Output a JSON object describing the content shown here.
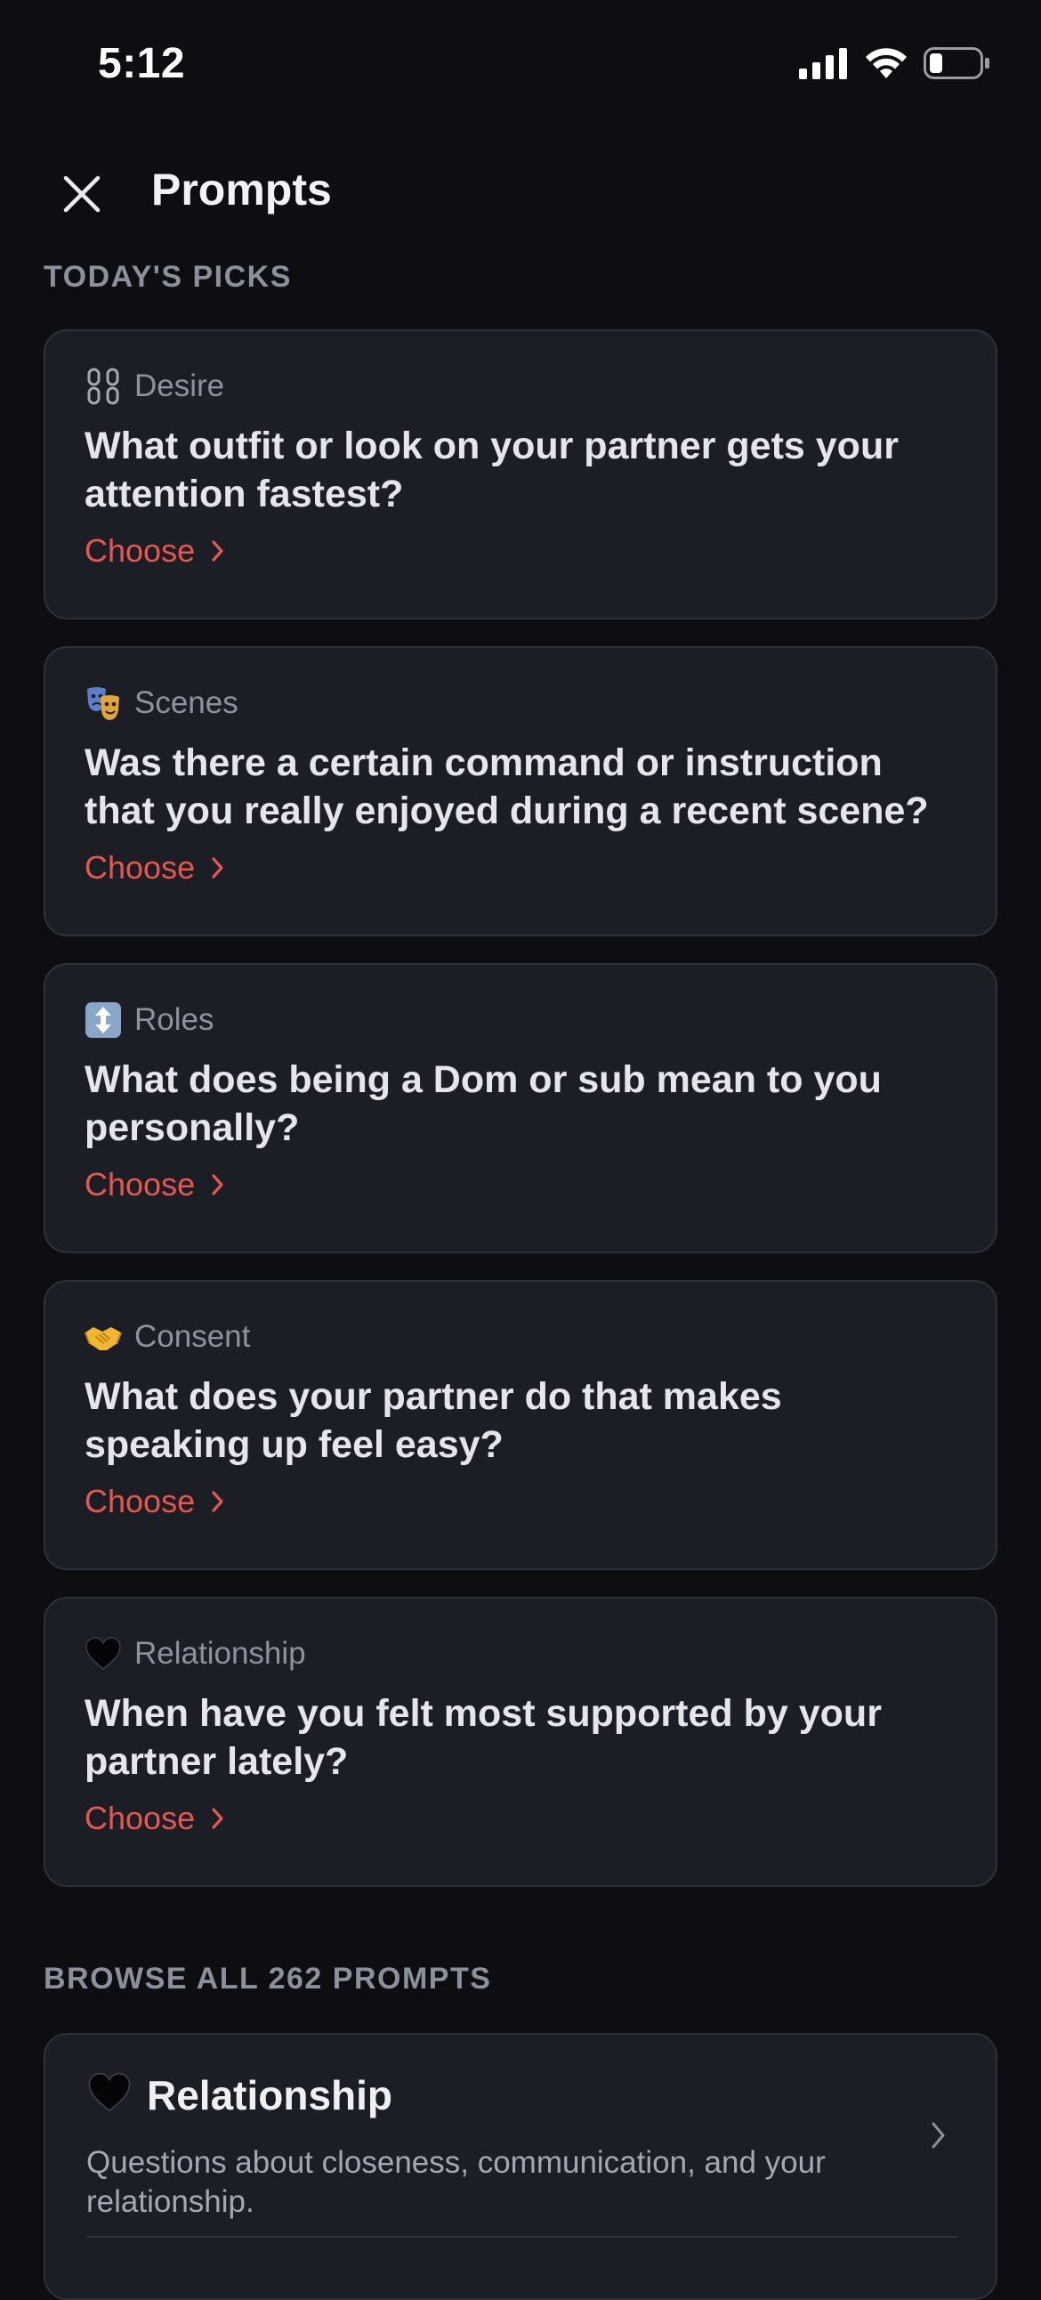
{
  "status_bar": {
    "time": "5:12"
  },
  "header": {
    "title": "Prompts"
  },
  "todays_picks": {
    "label": "TODAY'S PICKS",
    "cards": [
      {
        "category": "Desire",
        "icon": "chains-icon",
        "question": "What outfit or look on your partner gets your attention fastest?",
        "action": "Choose"
      },
      {
        "category": "Scenes",
        "icon": "theater-masks-icon",
        "question": "Was there a certain command or instruction that you really enjoyed during a recent scene?",
        "action": "Choose"
      },
      {
        "category": "Roles",
        "icon": "up-down-arrow-icon",
        "question": "What does being a Dom or sub mean to you personally?",
        "action": "Choose"
      },
      {
        "category": "Consent",
        "icon": "handshake-icon",
        "question": "What does your partner do that makes speaking up feel easy?",
        "action": "Choose"
      },
      {
        "category": "Relationship",
        "icon": "black-heart-icon",
        "question": "When have you felt most supported by your partner lately?",
        "action": "Choose"
      }
    ]
  },
  "browse": {
    "label": "BROWSE ALL 262 PROMPTS",
    "categories": [
      {
        "title": "Relationship",
        "icon": "black-heart-icon",
        "description": "Questions about closeness, communication, and your relationship."
      }
    ]
  },
  "colors": {
    "background": "#0d0e12",
    "card": "#1b1e25",
    "card_border": "#2c313b",
    "accent": "#e5584f",
    "muted_text": "#8d929e"
  }
}
